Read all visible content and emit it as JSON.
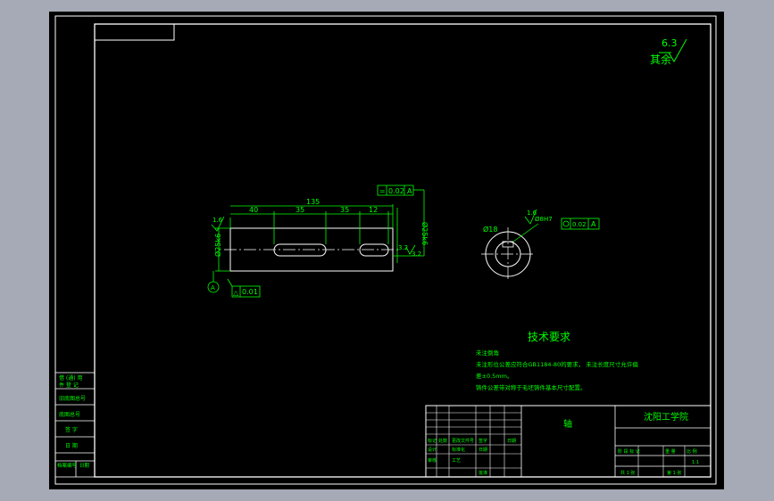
{
  "drawing": {
    "surface_roughness_value": "6.3",
    "surface_roughness_label": "其余",
    "dims": {
      "total_length": "135",
      "seg1": "40",
      "seg2": "35",
      "seg3": "35",
      "seg4": "12",
      "diameter_left": "Ø25k6",
      "diameter_right": "Ø25k6",
      "roughness_left": "1.6",
      "roughness_right": "3.2",
      "roughness_right2": "3.2",
      "flatness_value": "0.02",
      "flatness_datum": "A",
      "datum_label": "A",
      "straightness_value": "0.01"
    },
    "section": {
      "diameter": "Ø18",
      "roughness": "1.6",
      "keyway": "Ø8H7",
      "tolerance_value": "0.02",
      "tolerance_datum": "A"
    },
    "tech_title": "技术要求",
    "tech_lines": [
      "未注倒角",
      "未注形位公差应符合GB1184-80的要求， 未注长度尺寸允许偏",
      "差±0.5mm。",
      "铸件公差带对称于毛坯铸件基本尺寸配置。"
    ],
    "left_panel": [
      "借 (通) 用",
      "件 登 记",
      "旧底图总号",
      "底图总号",
      "签 字",
      "日 期",
      "档案编号",
      "日期"
    ],
    "title_block": {
      "material": "轴",
      "school": "沈阳工学院",
      "rows_labels": [
        "标记",
        "处数",
        "更改文件号",
        "签字",
        "日期"
      ],
      "designer_row": [
        "设计",
        "",
        "标准化",
        "",
        "日期"
      ],
      "review_row": [
        "审核",
        "",
        "工艺",
        ""
      ],
      "approve": "批准",
      "stage_labels": [
        "阶 段 标 记",
        "重 量",
        "比 例"
      ],
      "scale": "1:1",
      "sheet_labels": [
        "共 1 张",
        "第 1 张"
      ]
    }
  }
}
